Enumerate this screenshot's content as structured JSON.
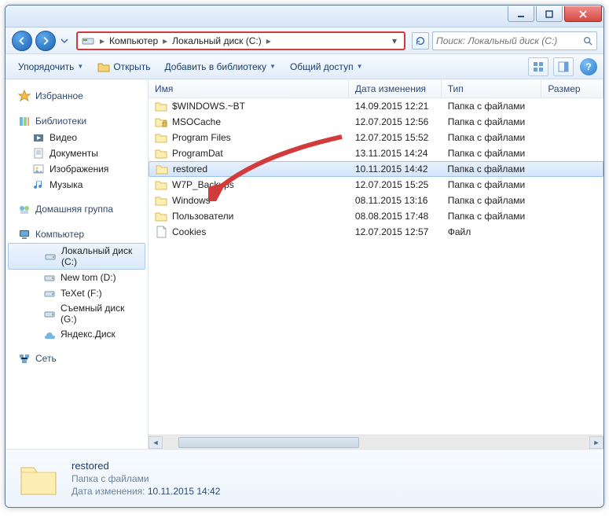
{
  "breadcrumb": {
    "root": "Компьютер",
    "sep": "▸",
    "current": "Локальный диск (C:)"
  },
  "search": {
    "placeholder": "Поиск: Локальный диск (C:)"
  },
  "toolbar": {
    "organize": "Упорядочить",
    "open": "Открыть",
    "addlib": "Добавить в библиотеку",
    "share": "Общий доступ"
  },
  "sidebar": {
    "favorites": "Избранное",
    "libraries": "Библиотеки",
    "lib_items": [
      "Видео",
      "Документы",
      "Изображения",
      "Музыка"
    ],
    "homegroup": "Домашняя группа",
    "computer": "Компьютер",
    "drives": [
      {
        "label": "Локальный диск (C:)",
        "sel": true
      },
      {
        "label": "New tom (D:)",
        "sel": false
      },
      {
        "label": "TeXet (F:)",
        "sel": false
      },
      {
        "label": "Съемный диск (G:)",
        "sel": false
      },
      {
        "label": "Яндекс.Диск",
        "sel": false
      }
    ],
    "network": "Сеть"
  },
  "columns": {
    "name": "Имя",
    "date": "Дата изменения",
    "type": "Тип",
    "size": "Размер"
  },
  "rows": [
    {
      "icon": "folder",
      "name": "$WINDOWS.~BT",
      "date": "14.09.2015 12:21",
      "type": "Папка с файлами",
      "sel": false
    },
    {
      "icon": "folder-lock",
      "name": "MSOCache",
      "date": "12.07.2015 12:56",
      "type": "Папка с файлами",
      "sel": false
    },
    {
      "icon": "folder",
      "name": "Program Files",
      "date": "12.07.2015 15:52",
      "type": "Папка с файлами",
      "sel": false
    },
    {
      "icon": "folder",
      "name": "ProgramDat",
      "date": "13.11.2015 14:24",
      "type": "Папка с файлами",
      "sel": false
    },
    {
      "icon": "folder",
      "name": "restored",
      "date": "10.11.2015 14:42",
      "type": "Папка с файлами",
      "sel": true
    },
    {
      "icon": "folder",
      "name": "W7P_Backups",
      "date": "12.07.2015 15:25",
      "type": "Папка с файлами",
      "sel": false
    },
    {
      "icon": "folder",
      "name": "Windows",
      "date": "08.11.2015 13:16",
      "type": "Папка с файлами",
      "sel": false
    },
    {
      "icon": "folder",
      "name": "Пользователи",
      "date": "08.08.2015 17:48",
      "type": "Папка с файлами",
      "sel": false
    },
    {
      "icon": "file",
      "name": "Cookies",
      "date": "12.07.2015 12:57",
      "type": "Файл",
      "sel": false
    }
  ],
  "details": {
    "name": "restored",
    "type": "Папка с файлами",
    "meta_label": "Дата изменения:",
    "meta_value": "10.11.2015 14:42"
  }
}
